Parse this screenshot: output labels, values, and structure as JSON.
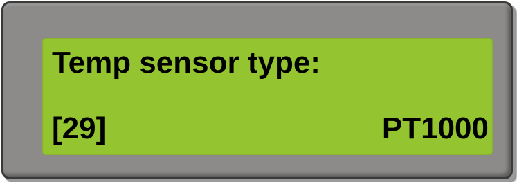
{
  "display": {
    "line1": "Temp sensor type:",
    "param_index": "[29]",
    "param_value": "PT1000"
  },
  "colors": {
    "bezel": "#8d8b89",
    "bezel_border": "#3a3a3a",
    "screen": "#94c530",
    "text": "#000000"
  }
}
